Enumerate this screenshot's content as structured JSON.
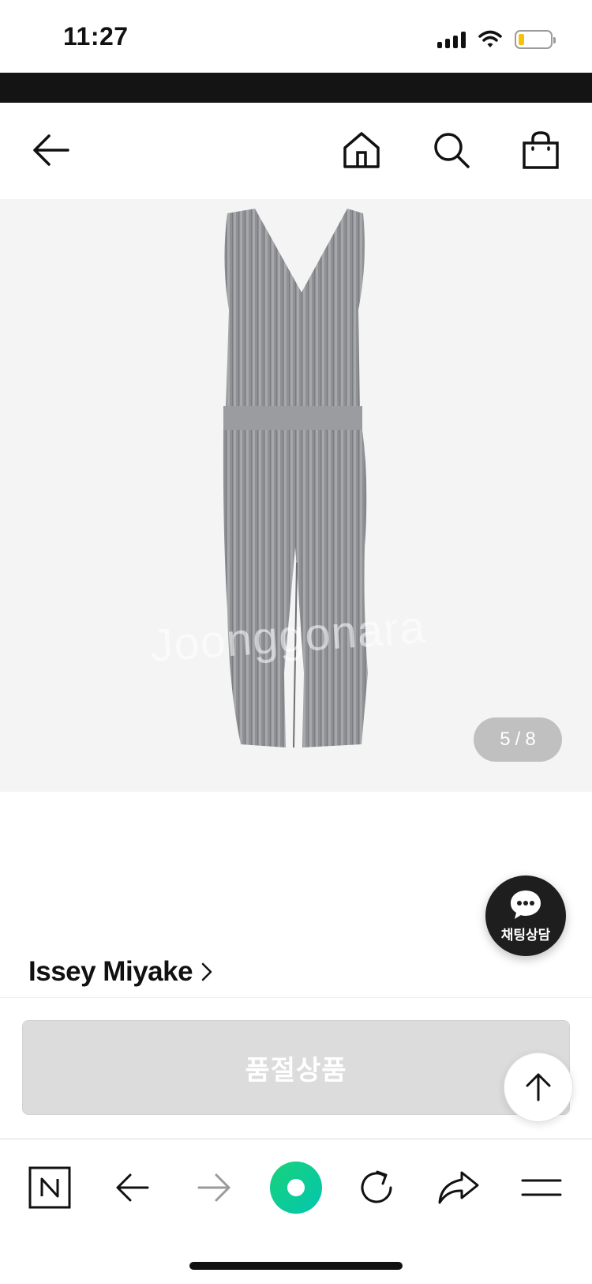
{
  "status_bar": {
    "time": "11:27",
    "icons": [
      "cellular-signal-icon",
      "wifi-icon",
      "battery-low-icon"
    ],
    "battery_color": "#f4c20d"
  },
  "top_nav": {
    "icons": [
      "back-arrow-icon",
      "home-icon",
      "search-icon",
      "shopping-bag-icon"
    ]
  },
  "gallery": {
    "watermark": "Joonggonara",
    "current_page": "5",
    "separator": "/",
    "total_pages": "8",
    "background": "#f4f4f4"
  },
  "chat_button": {
    "label": "채팅상담",
    "icon": "chat-bubble-icon"
  },
  "product": {
    "brand": "Issey Miyake",
    "brand_icon": "chevron-right-icon"
  },
  "purchase": {
    "soldout_label": "품절상품",
    "soldout_bg": "#dcdcdc"
  },
  "scroll_top": {
    "icon": "arrow-up-icon"
  },
  "browser_toolbar": {
    "icons": [
      "naver-n-icon",
      "back-icon",
      "forward-icon",
      "green-home-dot-icon",
      "refresh-icon",
      "share-icon",
      "menu-icon"
    ],
    "accent": "#03c75a"
  }
}
